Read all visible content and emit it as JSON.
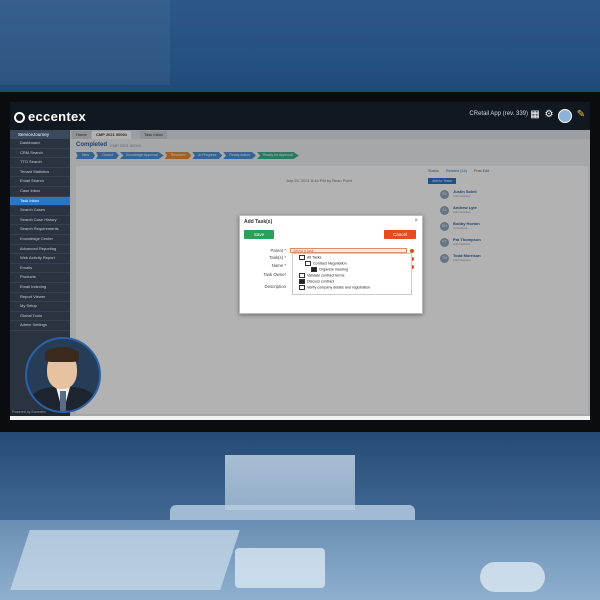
{
  "app": {
    "logo": "eccentex",
    "title": "CRetail App (rev. 339)"
  },
  "sidebar": {
    "header": "ServiceJourney",
    "items": [
      "Dashboard",
      "CRM Search",
      "TTO Search",
      "Tenant Statistics",
      "Email Search",
      "Case Inbox",
      "Task Inbox",
      "Search Cases",
      "Search Case History",
      "Search Requirements",
      "Knowledge Center",
      "Advanced Reporting",
      "Web Activity Report",
      "Emails",
      "Products",
      "Email Indexing",
      "Report Viewer",
      "My Setup",
      "Global Tools",
      "Admin Settings"
    ],
    "active_index": 6,
    "footer": "Powered by Eccentex"
  },
  "tabs": [
    "Home",
    "CMP 2021 00001",
    "Task Inbox"
  ],
  "record": {
    "title": "Completed",
    "status_text": "CMP 2021 00001"
  },
  "crumbs": [
    "New",
    "Closed",
    "Knowledge Approval",
    "Resolved",
    "In Progress",
    "Ready Action",
    "Ready for Approval"
  ],
  "crumb_colors": [
    "#4a90d9",
    "#4a90d9",
    "#4a90d9",
    "#e98a33",
    "#4a90d9",
    "#4a90d9",
    "#3bb08f"
  ],
  "right_panel": {
    "tabs": [
      "Status",
      "Related (14)",
      "Post Edit"
    ],
    "add_button": "Add to Team",
    "users": [
      {
        "initials": "SL",
        "name": "Justin Soleil",
        "role": "Administrator"
      },
      {
        "initials": "AL",
        "name": "Andrew Lyte",
        "role": "Administrator"
      },
      {
        "initials": "BH",
        "name": "Bobby Horton",
        "role": "Consultant"
      },
      {
        "initials": "PT",
        "name": "Pat Thompson",
        "role": "Administrator"
      },
      {
        "initials": "TM",
        "name": "Todd Morrison",
        "role": "Administrator"
      }
    ]
  },
  "date_text": "July 25, 2021 8:46 PM by Bean Point",
  "modal": {
    "title": "Add Task(s)",
    "save": "Save",
    "cancel": "Cancel",
    "labels": [
      "Parent *",
      "Task(s) *",
      "Name *",
      "Task Owner",
      "Description"
    ],
    "parent_placeholder": "Select a task",
    "dropdown": [
      "All Tasks",
      "Contract Negotiation",
      "Organize meeting",
      "Validate contract terms",
      "Discuss contract",
      "Verify company details and registration"
    ]
  }
}
